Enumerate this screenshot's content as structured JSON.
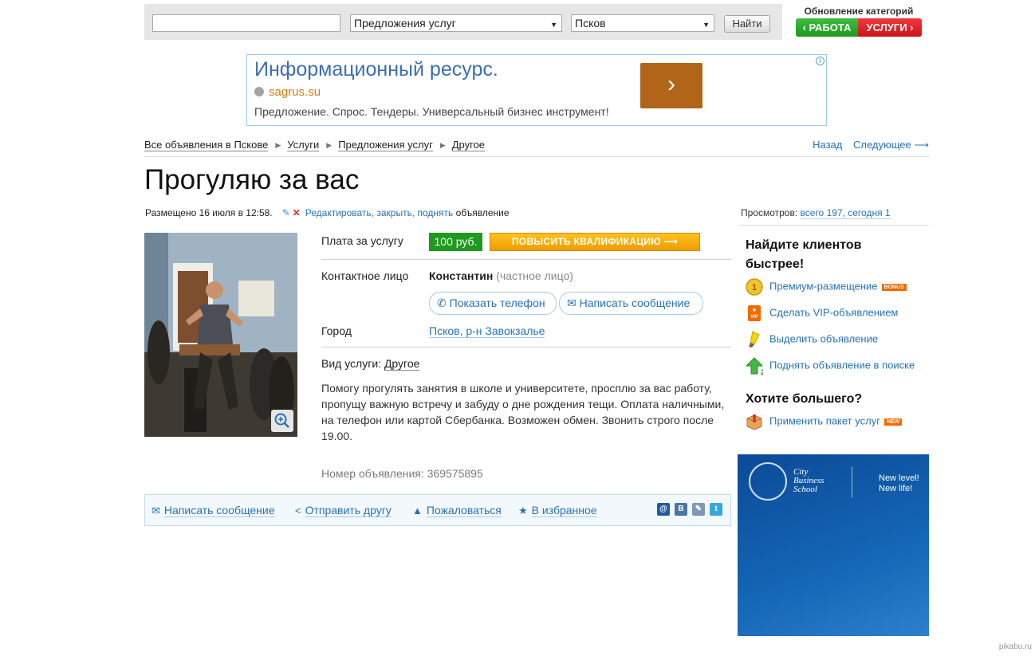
{
  "search": {
    "query_value": "",
    "category": "Предложения услуг",
    "city": "Псков",
    "find_label": "Найти"
  },
  "cat_update": {
    "title": "Обновление категорий",
    "work": "‹ РАБОТА",
    "services": "УСЛУГИ ›"
  },
  "ad": {
    "title": "Информационный ресурс.",
    "url": "sagrus.su",
    "description": "Предложение. Спрос. Тендеры. Универсальный бизнес инструмент!",
    "go_arrow": "›",
    "info_label": "i"
  },
  "breadcrumb": [
    "Все объявления в Пскове",
    "Услуги",
    "Предложения услуг",
    "Другое"
  ],
  "pager": {
    "back": "Назад",
    "next": "Следующее ⟶"
  },
  "listing": {
    "title": "Прогуляю за вас",
    "posted": "Размещено 16 июля в 12:58.",
    "edit_links": "Редактировать, закрыть, поднять",
    "edit_suffix": "объявление",
    "views_label": "Просмотров:",
    "views_value": "всего 197, сегодня 1",
    "fee_label": "Плата за услугу",
    "fee_value": "100 руб.",
    "upgrade_label": "ПОВЫСИТЬ КВАЛИФИКАЦИЮ   ⟶",
    "contact_label": "Контактное лицо",
    "contact_name": "Константин",
    "contact_type": "(частное лицо)",
    "show_phone": "Показать телефон",
    "write_message": "Написать сообщение",
    "city_label": "Город",
    "city_value": "Псков, р-н Завокзалье",
    "service_type_label": "Вид услуги:",
    "service_type_value": "Другое",
    "description": "Помогу прогулять занятия в школе и университете, просплю за вас работу, пропущу важную встречу и забуду о дне рождения тещи. Оплата наличными, на телефон или картой Сбербанка. Возможен обмен. Звонить строго после 19.00.",
    "number_label": "Номер объявления:",
    "number_value": "369575895"
  },
  "actions": {
    "message": "Написать сообщение",
    "send_friend": "Отправить другу",
    "complain": "Пожаловаться",
    "favorite": "В избранное",
    "social": [
      "@",
      "В",
      "✎",
      "t"
    ]
  },
  "sidebar": {
    "heading1": "Найдите клиентов быстрее!",
    "items": [
      {
        "label": "Премиум-размещение",
        "badge": "BONUS",
        "icon": "coin-icon"
      },
      {
        "label": "Сделать VIP-объявлением",
        "badge": "",
        "icon": "vip-icon"
      },
      {
        "label": "Выделить объявление",
        "badge": "",
        "icon": "highlighter-icon"
      },
      {
        "label": "Поднять объявление в поиске",
        "badge": "",
        "icon": "arrow-up-icon"
      }
    ],
    "heading2": "Хотите большего?",
    "package": {
      "label": "Применить пакет услуг",
      "badge": "NEW",
      "icon": "box-icon"
    }
  },
  "banner": {
    "brand": [
      "City",
      "Business",
      "School"
    ],
    "slogan": [
      "New level!",
      "New life!"
    ]
  },
  "watermark": "pikabu.ru",
  "colors": {
    "link": "#2673b8",
    "price_green": "#1e9a1e",
    "upgrade_orange": "#ee9b00",
    "work_green": "#1e9a1e",
    "services_red": "#cc1418",
    "ad_button": "#b06518"
  }
}
